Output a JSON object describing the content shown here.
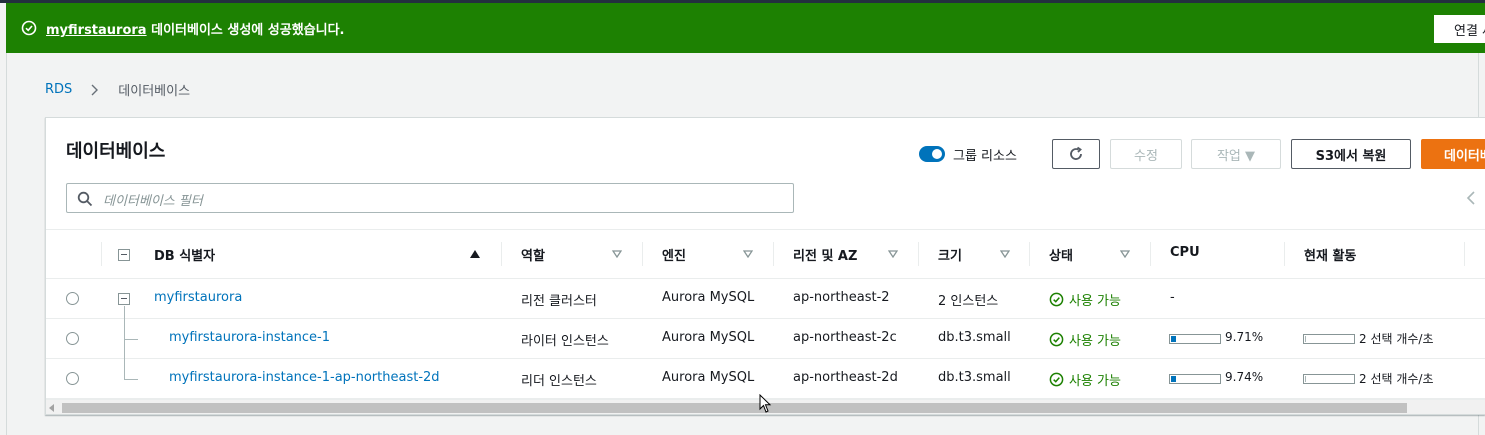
{
  "flash": {
    "db_link": "myfirstaurora",
    "message": " 데이터베이스 생성에 성공했습니다.",
    "connect_label": "연결 세부 정보 보기"
  },
  "breadcrumb": {
    "root": "RDS",
    "current": "데이터베이스"
  },
  "panel": {
    "title": "데이터베이스",
    "group_toggle_label": "그룹 리소스",
    "modify_label": "수정",
    "actions_label": "작업 ▼",
    "restore_label": "S3에서 복원",
    "create_label": "데이터베이스 생성"
  },
  "filter": {
    "placeholder": "데이터베이스 필터"
  },
  "columns": {
    "db_id": "DB 식별자",
    "role": "역할",
    "engine": "엔진",
    "region": "리전 및 AZ",
    "size": "크기",
    "status": "상태",
    "cpu": "CPU",
    "activity": "현재 활동"
  },
  "rows": [
    {
      "id": "myfirstaurora",
      "role": "리전 클러스터",
      "engine": "Aurora MySQL",
      "region": "ap-northeast-2",
      "size": "2 인스턴스",
      "status": "사용 가능",
      "cpu": "-",
      "cpu_pct": null,
      "activity": ""
    },
    {
      "id": "myfirstaurora-instance-1",
      "role": "라이터 인스턴스",
      "engine": "Aurora MySQL",
      "region": "ap-northeast-2c",
      "size": "db.t3.small",
      "status": "사용 가능",
      "cpu": "9.71%",
      "cpu_pct": 9.71,
      "activity": "2 선택 개수/초"
    },
    {
      "id": "myfirstaurora-instance-1-ap-northeast-2d",
      "role": "리더 인스턴스",
      "engine": "Aurora MySQL",
      "region": "ap-northeast-2d",
      "size": "db.t3.small",
      "status": "사용 가능",
      "cpu": "9.74%",
      "cpu_pct": 9.74,
      "activity": "2 선택 개수/초"
    }
  ],
  "colors": {
    "success": "#1d8102",
    "link": "#0073bb",
    "primary": "#ec7211"
  }
}
